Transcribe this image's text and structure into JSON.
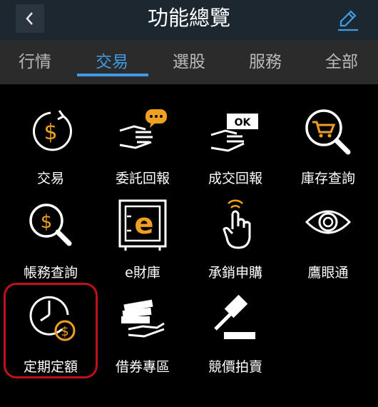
{
  "header": {
    "title": "功能總覽"
  },
  "tabs": [
    {
      "label": "行情",
      "active": false
    },
    {
      "label": "交易",
      "active": true
    },
    {
      "label": "選股",
      "active": false
    },
    {
      "label": "服務",
      "active": false
    },
    {
      "label": "全部",
      "active": false
    }
  ],
  "features": [
    {
      "label": "交易",
      "icon": "dollar-cycle-icon"
    },
    {
      "label": "委託回報",
      "icon": "hand-chat-icon"
    },
    {
      "label": "成交回報",
      "icon": "ok-ticket-icon"
    },
    {
      "label": "庫存查詢",
      "icon": "cart-search-icon"
    },
    {
      "label": "帳務查詢",
      "icon": "dollar-search-icon"
    },
    {
      "label": "e財庫",
      "icon": "e-safe-icon"
    },
    {
      "label": "承銷申購",
      "icon": "tap-hand-icon"
    },
    {
      "label": "鷹眼通",
      "icon": "eye-icon"
    },
    {
      "label": "定期定額",
      "icon": "clock-dollar-icon"
    },
    {
      "label": "借券專區",
      "icon": "money-stack-hand-icon"
    },
    {
      "label": "競價拍賣",
      "icon": "gavel-icon"
    }
  ],
  "colors": {
    "accent": "#3f9be6",
    "icon_orange": "#f0a020",
    "highlight": "#c0101a"
  }
}
